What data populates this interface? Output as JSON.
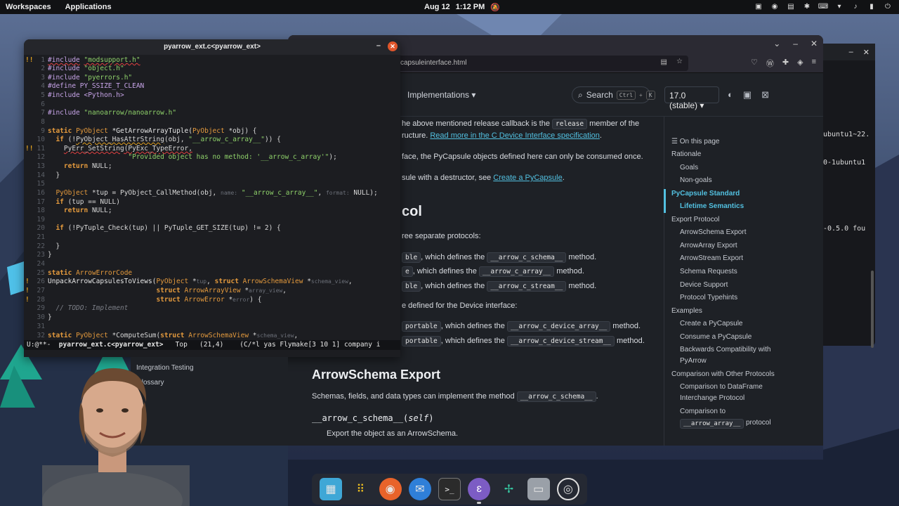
{
  "topbar": {
    "workspaces": "Workspaces",
    "applications": "Applications",
    "date": "Aug 12",
    "time": "1:12 PM"
  },
  "terminal": {
    "lines": [
      "ubuntu1~22.",
      "0-1ubuntu1",
      "-0.5.0 fou"
    ]
  },
  "browser": {
    "url": "capsuleinterface.html",
    "nav_implementations": "Implementations",
    "search_label": "Search",
    "search_key1": "Ctrl",
    "search_key2": "K",
    "version": "17.0 (stable)",
    "content": {
      "l1a": "he above mentioned release callback is the",
      "l1code": "release",
      "l1b": "member of the",
      "l2a": "ructure.",
      "l2link": "Read more in the C Device Interface specification",
      "l2b": ".",
      "l3": "face, the PyCapsule objects defined here can only be consumed once.",
      "l4a": "sule with a destructor, see",
      "l4link": "Create a PyCapsule",
      "l4b": ".",
      "h_col": "col",
      "l5": "ree separate protocols:",
      "r1a": "ble",
      "r1b": ", which defines the",
      "r1code": "__arrow_c_schema__",
      "r1c": "method.",
      "r2a": "e",
      "r2b": ", which defines the",
      "r2code": "__arrow_c_array__",
      "r2c": "method.",
      "r3a": "ble",
      "r3b": ", which defines the",
      "r3code": "__arrow_c_stream__",
      "r3c": "method.",
      "l6": "e defined for the Device interface:",
      "d1a": "portable",
      "d1b": ", which defines the",
      "d1code": "__arrow_c_device_array__",
      "d1c": "method.",
      "d2a": "portable",
      "d2b": ", which defines the",
      "d2code": "__arrow_c_device_stream__",
      "d2c": "method.",
      "h_schema": "ArrowSchema Export",
      "l7a": "Schemas, fields, and data types can implement the method",
      "l7code": "__arrow_c_schema__",
      "l7b": ".",
      "sig_name": "__arrow_c_schema__",
      "sig_arg": "self",
      "l8": "Export the object as an ArrowSchema."
    },
    "toc": {
      "heading": "On this page",
      "items": [
        {
          "label": "Rationale",
          "level": "top"
        },
        {
          "label": "Goals",
          "level": "sub"
        },
        {
          "label": "Non-goals",
          "level": "sub"
        },
        {
          "label": "PyCapsule Standard",
          "level": "top"
        },
        {
          "label": "Lifetime Semantics",
          "level": "sub"
        },
        {
          "label": "Export Protocol",
          "level": "top"
        },
        {
          "label": "ArrowSchema Export",
          "level": "sub"
        },
        {
          "label": "ArrowArray Export",
          "level": "sub"
        },
        {
          "label": "ArrowStream Export",
          "level": "sub"
        },
        {
          "label": "Schema Requests",
          "level": "sub"
        },
        {
          "label": "Device Support",
          "level": "sub"
        },
        {
          "label": "Protocol Typehints",
          "level": "sub"
        },
        {
          "label": "Examples",
          "level": "top"
        },
        {
          "label": "Create a PyCapsule",
          "level": "sub"
        },
        {
          "label": "Consume a PyCapsule",
          "level": "sub"
        },
        {
          "label": "Backwards Compatibility with",
          "level": "sub"
        },
        {
          "label": "PyArrow",
          "level": "sub"
        },
        {
          "label": "Comparison with Other Protocols",
          "level": "top"
        },
        {
          "label": "Comparison to DataFrame",
          "level": "sub"
        },
        {
          "label": "Interchange Protocol",
          "level": "sub"
        },
        {
          "label": "Comparison to",
          "level": "sub"
        },
        {
          "label": "__arrow_array__",
          "level": "sub"
        },
        {
          "label": "protocol",
          "level": "sub"
        }
      ]
    },
    "leftnav": [
      "Integration Testing",
      "Glossary"
    ]
  },
  "editor": {
    "title": "pyarrow_ext.c<pyarrow_ext>",
    "modeline": {
      "state": "U:@**-",
      "buffer": "pyarrow_ext.c<pyarrow_ext>",
      "pos": "Top",
      "linecol": "(21,4)",
      "modes": "(C/*l yas Flymake[3 10 1] company i"
    },
    "hints": {
      "name": "name:",
      "format": "format:",
      "tup": "tup",
      "schema_view": "schema_view",
      "array_view": "array_view",
      "error": "error",
      "schema_view2": "schema_view"
    },
    "code": {
      "l1a": "#include",
      "l1b": "\"modsupport.h\"",
      "l2a": "#include",
      "l2b": "\"object.h\"",
      "l3a": "#include",
      "l3b": "\"pyerrors.h\"",
      "l4": "#define PY_SSIZE_T_CLEAN",
      "l5": "#include <Python.h>",
      "l7a": "#include",
      "l7b": "\"nanoarrow/nanoarrow.h\"",
      "l9a": "static",
      "l9b": "PyObject",
      "l9c": "*GetArrowArrayTuple(",
      "l9d": "PyObject",
      "l9e": "*obj) {",
      "l10a": "if",
      "l10b": "(!",
      "l10c": "PyObject_HasAttrString",
      "l10d": "(obj,",
      "l10e": "\"__arrow_c_array__\"",
      "l10f": ")) {",
      "l11a": "PyErr_SetString",
      "l11b": "(PyExc_TypeError,",
      "l12": "\"Provided object has no method: '__arrow_c_array'\"",
      "l12b": ");",
      "l13a": "return",
      "l13b": "NULL;",
      "l14": "}",
      "l16a": "PyObject",
      "l16b": "*tup = PyObject_CallMethod(obj,",
      "l16c": "\"__arrow_c_array__\"",
      "l16d": ",",
      "l16e": "NULL);",
      "l17a": "if",
      "l17b": "(tup == NULL)",
      "l18a": "return",
      "l18b": "NULL;",
      "l20a": "if",
      "l20b": "(!PyTuple_Check(tup) || PyTuple_GET_SIZE(tup) != 2) {",
      "l22": "}",
      "l23": "}",
      "l25a": "static",
      "l25b": "ArrowErrorCode",
      "l26a": "UnpackArrowCapsulesToViews(",
      "l26b": "PyObject",
      "l26c": "*",
      "l26d": ",",
      "l26e": "struct",
      "l26f": "ArrowSchemaView",
      "l26g": "*",
      "l27a": "struct",
      "l27b": "ArrowArrayView",
      "l27c": "*",
      "l28a": "struct",
      "l28b": "ArrowError",
      "l28c": "*",
      "l28d": ") {",
      "l29": "// TODO: Implement",
      "l30": "}",
      "l32a": "static",
      "l32b": "PyObject",
      "l32c": "*ComputeSum(",
      "l32d": "struct",
      "l32e": "ArrowSchemaView",
      "l32f": "*"
    }
  }
}
